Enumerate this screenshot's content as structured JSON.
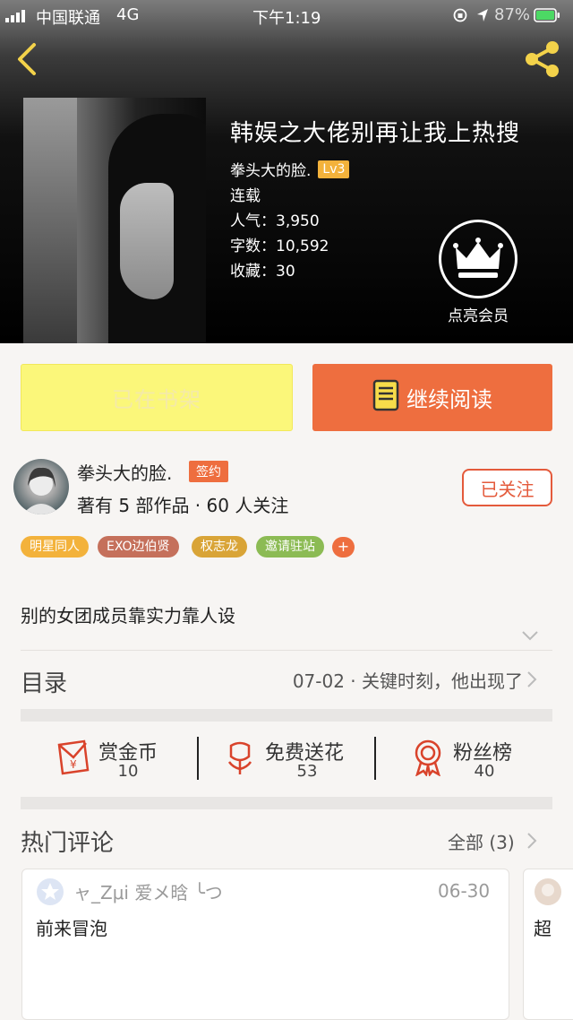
{
  "status_bar": {
    "carrier": "中国联通",
    "network": "4G",
    "time": "下午1:19",
    "battery": "87%"
  },
  "book": {
    "title": "韩娱之大佬别再让我上热搜",
    "author": "拳头大的脸.",
    "level": "Lv3",
    "status": "连载",
    "popularity_label": "人气：",
    "popularity": "3,950",
    "words_label": "字数：",
    "words": "10,592",
    "favorites_label": "收藏：",
    "favorites": "30",
    "vip_label": "点亮会员"
  },
  "buttons": {
    "shelf": "已在书架",
    "read": "继续阅读"
  },
  "author": {
    "name": "拳头大的脸.",
    "badge": "签约",
    "meta": "著有 5 部作品 · 60 人关注",
    "follow": "已关注"
  },
  "tags": [
    {
      "label": "明星同人",
      "color": "#f3b23b"
    },
    {
      "label": "EXO边伯贤",
      "color": "#c5705b"
    },
    {
      "label": "权志龙",
      "color": "#d9a437"
    },
    {
      "label": "邀请驻站",
      "color": "#8cbb54"
    }
  ],
  "tag_add": "+",
  "intro": "别的女团成员靠实力靠人设",
  "toc": {
    "label": "目录",
    "latest": "07-02 · 关键时刻，他出现了"
  },
  "actions": [
    {
      "label": "赏金币",
      "count": "10"
    },
    {
      "label": "免费送花",
      "count": "53"
    },
    {
      "label": "粉丝榜",
      "count": "40"
    }
  ],
  "comments": {
    "label": "热门评论",
    "all": "全部 (3)",
    "items": [
      {
        "user": "ャ_Zμi 爱メ晗 ╰つ",
        "date": "06-30",
        "body": "前来冒泡"
      },
      {
        "body": "超"
      }
    ]
  },
  "colors": {
    "accent": "#ee6e3f",
    "shelf_button": "#fbf77a",
    "follow": "#e45a3b",
    "icon_red": "#d9432b"
  }
}
